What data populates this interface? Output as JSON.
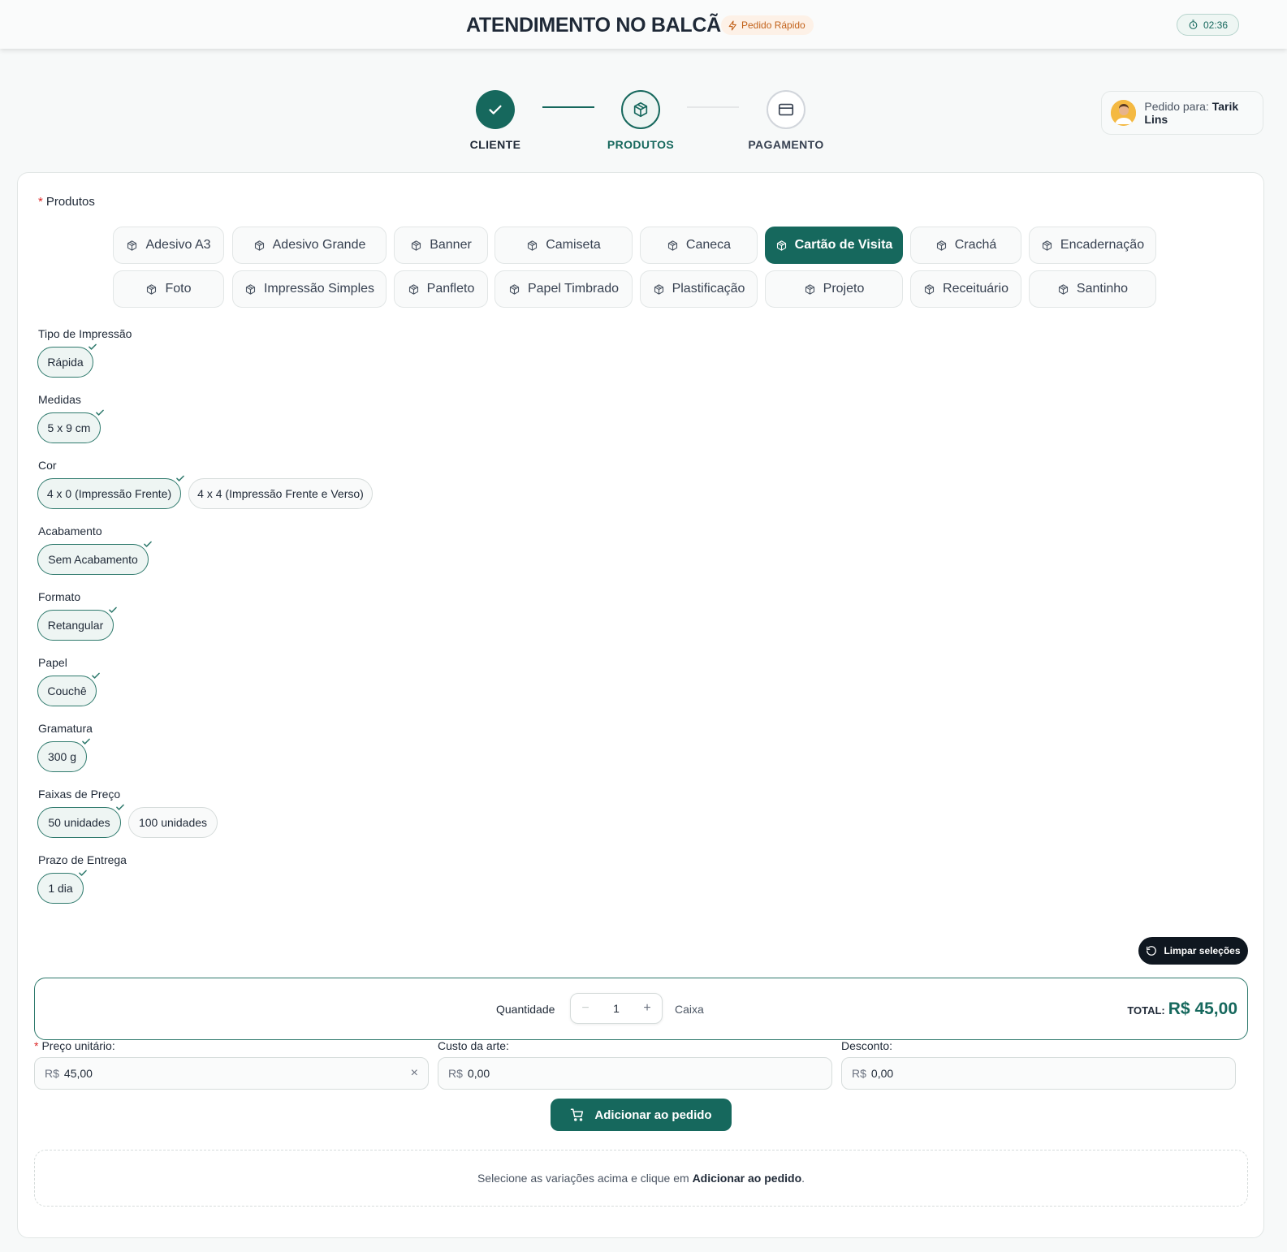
{
  "header": {
    "title": "ATENDIMENTO NO BALCÃO",
    "badge": "Pedido Rápido",
    "timer": "02:36"
  },
  "steps": [
    {
      "label": "CLIENTE",
      "state": "done"
    },
    {
      "label": "PRODUTOS",
      "state": "current"
    },
    {
      "label": "PAGAMENTO",
      "state": "pending"
    }
  ],
  "pedido_para": {
    "prefix": "Pedido para:",
    "name": "Tarik Lins"
  },
  "produtos": {
    "title": "Produtos",
    "items": [
      "Adesivo A3",
      "Adesivo Grande",
      "Banner",
      "Camiseta",
      "Caneca",
      "Cartão de Visita",
      "Crachá",
      "Encadernação",
      "Foto",
      "Impressão Simples",
      "Panfleto",
      "Papel Timbrado",
      "Plastificação",
      "Projeto",
      "Receituário",
      "Santinho"
    ],
    "selected": "Cartão de Visita"
  },
  "variacoes": [
    {
      "label": "Tipo de Impressão",
      "options": [
        "Rápida"
      ],
      "selected": 0
    },
    {
      "label": "Medidas",
      "options": [
        "5 x 9 cm"
      ],
      "selected": 0
    },
    {
      "label": "Cor",
      "options": [
        "4 x 0 (Impressão Frente)",
        "4 x 4 (Impressão Frente e Verso)"
      ],
      "selected": 0
    },
    {
      "label": "Acabamento",
      "options": [
        "Sem Acabamento"
      ],
      "selected": 0
    },
    {
      "label": "Formato",
      "options": [
        "Retangular"
      ],
      "selected": 0
    },
    {
      "label": "Papel",
      "options": [
        "Couchê"
      ],
      "selected": 0
    },
    {
      "label": "Gramatura",
      "options": [
        "300 g"
      ],
      "selected": 0
    },
    {
      "label": "Faixas de Preço",
      "options": [
        "50 unidades",
        "100 unidades"
      ],
      "selected": 0
    },
    {
      "label": "Prazo de Entrega",
      "options": [
        "1 dia"
      ],
      "selected": 0
    }
  ],
  "limpar_label": "Limpar seleções",
  "quantidade": {
    "label": "Quantidade",
    "value": "1",
    "minus": "−",
    "plus": "+",
    "unit": "Caixa",
    "total_label": "TOTAL:",
    "total_value": "R$ 45,00"
  },
  "campos": {
    "preco": {
      "label": "Preço unitário:",
      "currency": "R$",
      "value": "45,00",
      "clear": "×"
    },
    "arte": {
      "label": "Custo da arte:",
      "currency": "R$",
      "value": "0,00"
    },
    "desconto": {
      "label": "Desconto:",
      "currency": "R$",
      "value": "0,00"
    }
  },
  "adicionar_label": "Adicionar ao pedido",
  "hint": {
    "prefix": "Selecione as variações acima e clique em",
    "action": "Adicionar ao pedido",
    "suffix": "."
  },
  "colors": {
    "accent": "#16685d",
    "badge_text": "#c2621b",
    "badge_bg": "#fdf1e7",
    "required": "#dc2626"
  }
}
